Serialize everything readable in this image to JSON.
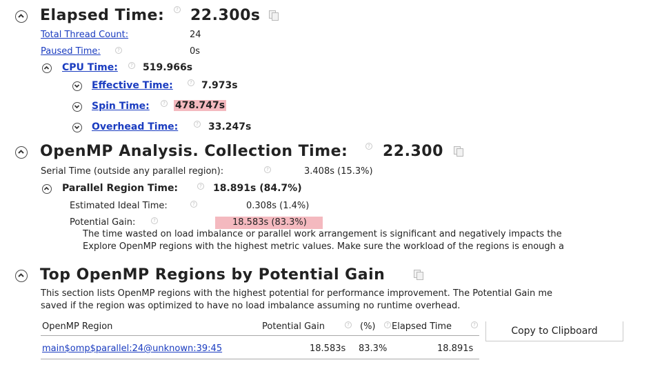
{
  "elapsed": {
    "title": "Elapsed Time:",
    "value": "22.300s",
    "rows": [
      {
        "label": "Total Thread Count:",
        "value": "24"
      },
      {
        "label": "Paused Time:",
        "value": "0s"
      }
    ],
    "cpu": {
      "label": "CPU Time:",
      "value": "519.966s"
    },
    "sub": [
      {
        "label": "Effective Time:",
        "value": "7.973s"
      },
      {
        "label": "Spin Time:",
        "value": "478.747s"
      },
      {
        "label": "Overhead Time:",
        "value": "33.247s"
      }
    ]
  },
  "openmp": {
    "title": "OpenMP Analysis. Collection Time:",
    "value": "22.300",
    "serial": {
      "label": "Serial Time (outside any parallel region):",
      "value": "3.408s (15.3%)"
    },
    "parallel": {
      "label": "Parallel Region Time:",
      "value": "18.891s (84.7%)"
    },
    "ideal": {
      "label": "Estimated Ideal Time:",
      "value": "0.308s (1.4%)"
    },
    "gain": {
      "label": "Potential Gain:",
      "value": "18.583s (83.3%)"
    },
    "note1": "The time wasted on load imbalance or parallel work arrangement is significant and negatively impacts the",
    "note2": "Explore OpenMP regions with the highest metric values. Make sure the workload of the regions is enough a"
  },
  "top": {
    "title": "Top OpenMP Regions by Potential Gain",
    "desc1": "This section lists OpenMP regions with the highest potential for performance improvement. The Potential Gain me",
    "desc2": "saved if the region was optimized to have no load imbalance assuming no runtime overhead.",
    "columns": {
      "region": "OpenMP Region",
      "gain": "Potential Gain",
      "pct": "(%)",
      "elapsed": "Elapsed Time"
    },
    "row": {
      "region": "main$omp$parallel:24@unknown:39:45",
      "gain": "18.583s",
      "pct": "83.3%",
      "elapsed": "18.891s"
    },
    "copy_label": "Copy to Clipboard"
  },
  "help_glyph": "?",
  "colors": {
    "link": "#1a3cc0",
    "highlight": "#f4b9bf"
  }
}
